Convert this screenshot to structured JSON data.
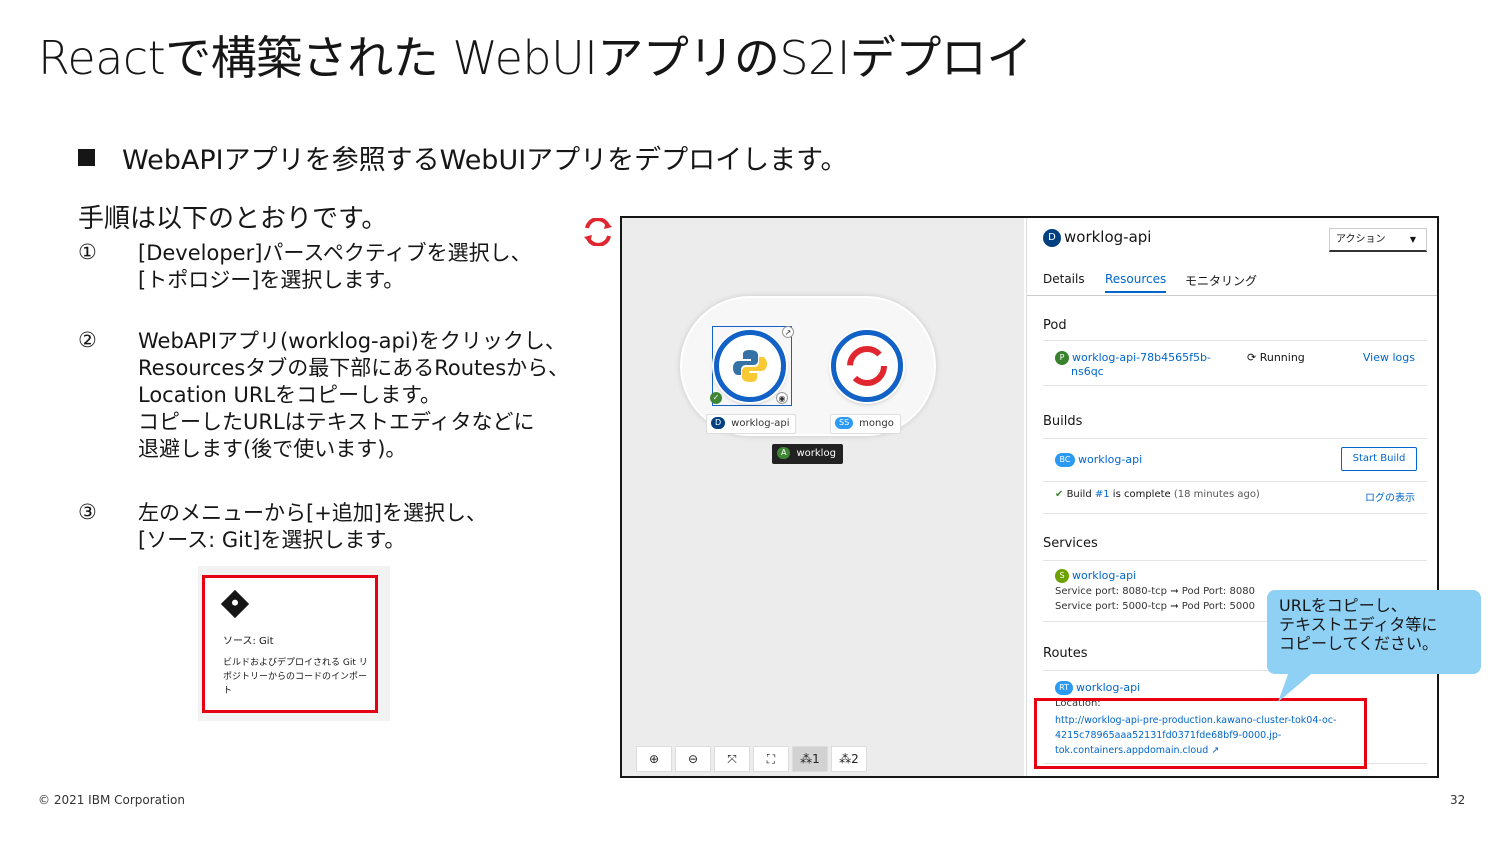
{
  "slide": {
    "title": "Reactで構築された WebUIアプリのS2Iデプロイ",
    "bullet": "WebAPIアプリを参照するWebUIアプリをデプロイします。",
    "intro": "手順は以下のとおりです。",
    "steps": [
      {
        "num": "①",
        "lines": [
          "[Developer]パースペクティブを選択し、",
          "[トポロジー]を選択します。"
        ]
      },
      {
        "num": "②",
        "lines": [
          "WebAPIアプリ(worklog-api)をクリックし、",
          "Resourcesタブの最下部にあるRoutesから、",
          "Location URLをコピーします。",
          "コピーしたURLはテキストエディタなどに",
          "退避します(後で使います)。"
        ]
      },
      {
        "num": "③",
        "lines": [
          "左のメニューから[+追加]を選択し、",
          "[ソース: Git]を選択します。"
        ]
      }
    ],
    "footer": "© 2021 IBM Corporation",
    "page": "32"
  },
  "git_card": {
    "title": "ソース: Git",
    "desc": "ビルドおよびデプロイされる Git リポジトリーからのコードのインポート"
  },
  "topology": {
    "nodes": [
      {
        "badge": "D",
        "name": "worklog-api"
      },
      {
        "badge": "SS",
        "name": "mongo"
      }
    ],
    "app": {
      "badge": "A",
      "name": "worklog"
    },
    "toolbar": [
      "⊕",
      "⊖",
      "⤧",
      "⛶",
      "⁂1",
      "⁂2"
    ]
  },
  "panel": {
    "title_badge": "D",
    "title": "worklog-api",
    "action": "アクション",
    "tabs": [
      "Details",
      "Resources",
      "モニタリング"
    ],
    "pod": {
      "header": "Pod",
      "badge": "P",
      "name_line1": "worklog-api-78b4565f5b-",
      "name_line2": "ns6qc",
      "status": "Running",
      "logs": "View logs"
    },
    "builds": {
      "header": "Builds",
      "badge": "BC",
      "name": "worklog-api",
      "start": "Start Build",
      "status_prefix": "Build",
      "status_link": "#1",
      "status_suffix": "is complete",
      "status_time": "(18 minutes ago)",
      "logs": "ログの表示"
    },
    "services": {
      "header": "Services",
      "badge": "S",
      "name": "worklog-api",
      "line1_label": "Service port:",
      "line1_value": "8080-tcp",
      "line1_pod": "Pod Port:",
      "line1_pod_value": "8080",
      "line2_label": "Service port:",
      "line2_value": "5000-tcp",
      "line2_pod": "Pod Port:",
      "line2_pod_value": "5000"
    },
    "routes": {
      "header": "Routes",
      "badge": "RT",
      "name": "worklog-api",
      "location_label": "Location:",
      "url_line1": "http://worklog-api-pre-production.kawano-cluster-tok04-oc-",
      "url_line2": "4215c78965aaa52131fd0371fde68bf9-0000.jp-",
      "url_line3": "tok.containers.appdomain.cloud"
    }
  },
  "callout": {
    "lines": [
      "URLをコピーし、",
      "テキストエディタ等に",
      "コピーしてください。"
    ]
  },
  "colors": {
    "highlight_red": "#e60012",
    "callout_blue": "#8fd0f5",
    "link_blue": "#0066cc",
    "openshift_red": "#e0262f"
  }
}
